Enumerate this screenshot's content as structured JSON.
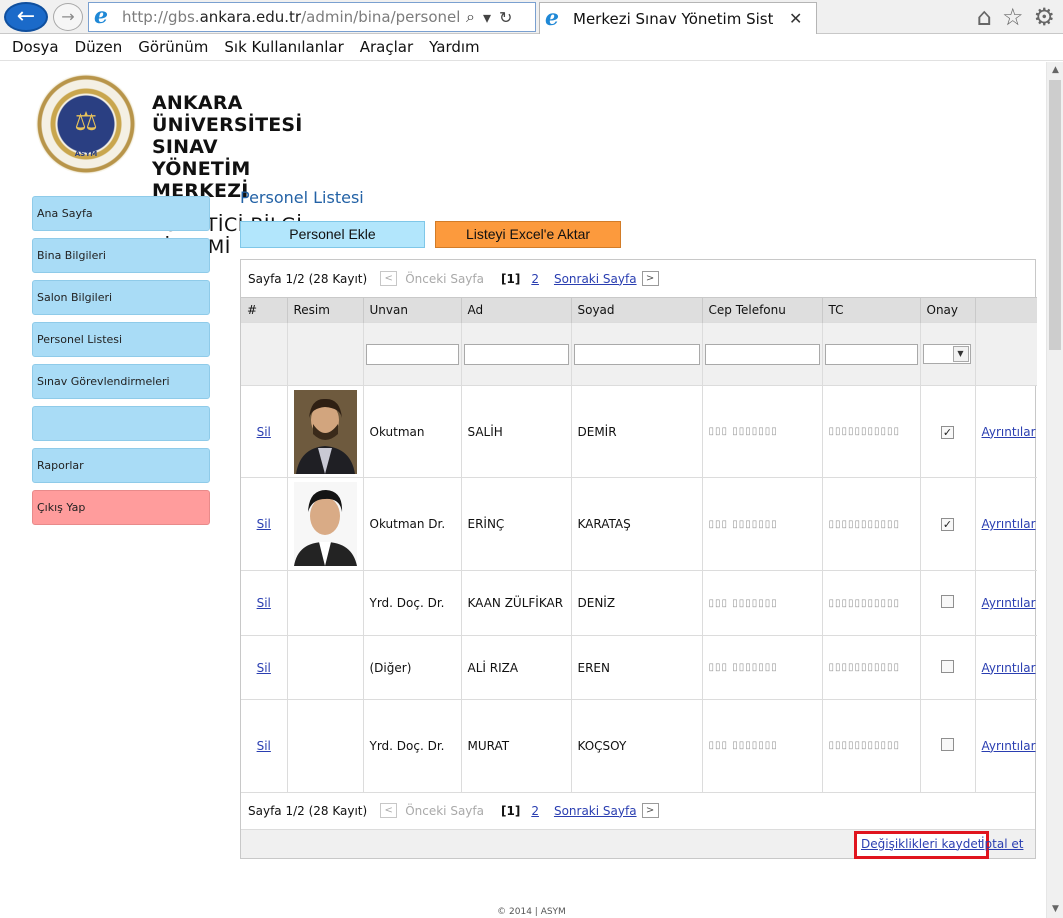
{
  "browser": {
    "url_prefix": "http://gbs.",
    "url_domain": "ankara.edu.tr",
    "url_path": "/admin/bina/personellistes",
    "tab_title": "Merkezi Sınav Yönetim Sist...",
    "tab_close": "✕"
  },
  "menubar": {
    "items": [
      "Dosya",
      "Düzen",
      "Görünüm",
      "Sık Kullanılanlar",
      "Araçlar",
      "Yardım"
    ]
  },
  "header": {
    "line1": "ANKARA ÜNİVERSİTESİ",
    "line2": "SINAV YÖNETİM MERKEZİ",
    "line3": "YÖNETİCİ BİLGİ SİSTEMİ",
    "logo_text": "ASYM"
  },
  "sidebar": {
    "items": [
      {
        "label": "Ana Sayfa"
      },
      {
        "label": "Bina Bilgileri"
      },
      {
        "label": "Salon Bilgileri"
      },
      {
        "label": "Personel Listesi"
      },
      {
        "label": "Sınav Görevlendirmeleri"
      },
      {
        "label": ""
      },
      {
        "label": "Raporlar"
      },
      {
        "label": "Çıkış Yap"
      }
    ]
  },
  "main": {
    "title": "Personel Listesi",
    "add_button": "Personel Ekle",
    "excel_button": "Listeyi Excel'e Aktar"
  },
  "pager": {
    "info": "Sayfa 1/2 (28 Kayıt)",
    "prev": "Önceki Sayfa",
    "current": "[1]",
    "page2": "2",
    "next": "Sonraki Sayfa"
  },
  "table": {
    "headers": [
      "#",
      "Resim",
      "Unvan",
      "Ad",
      "Soyad",
      "Cep Telefonu",
      "TC",
      "Onay",
      ""
    ],
    "rows": [
      {
        "action": "Sil",
        "unvan": "Okutman",
        "ad": "SALİH",
        "soyad": "DEMİR",
        "phone": "▯▯▯ ▯▯▯▯▯▯▯",
        "tc": "▯▯▯▯▯▯▯▯▯▯▯",
        "onay": true,
        "details": "Ayrıntılar"
      },
      {
        "action": "Sil",
        "unvan": "Okutman Dr.",
        "ad": "ERİNÇ",
        "soyad": "KARATAŞ",
        "phone": "▯▯▯ ▯▯▯▯▯▯▯",
        "tc": "▯▯▯▯▯▯▯▯▯▯▯",
        "onay": true,
        "details": "Ayrıntılar"
      },
      {
        "action": "Sil",
        "unvan": "Yrd. Doç. Dr.",
        "ad": "KAAN ZÜLFİKAR",
        "soyad": "DENİZ",
        "phone": "▯▯▯ ▯▯▯▯▯▯▯",
        "tc": "▯▯▯▯▯▯▯▯▯▯▯",
        "onay": false,
        "details": "Ayrıntılar"
      },
      {
        "action": "Sil",
        "unvan": "(Diğer)",
        "ad": "ALİ RIZA",
        "soyad": "EREN",
        "phone": "▯▯▯ ▯▯▯▯▯▯▯",
        "tc": "▯▯▯▯▯▯▯▯▯▯▯",
        "onay": false,
        "details": "Ayrıntılar"
      },
      {
        "action": "Sil",
        "unvan": "Yrd. Doç. Dr.",
        "ad": "MURAT",
        "soyad": "KOÇSOY",
        "phone": "▯▯▯ ▯▯▯▯▯▯▯",
        "tc": "▯▯▯▯▯▯▯▯▯▯▯",
        "onay": false,
        "details": "Ayrıntılar"
      }
    ]
  },
  "actions": {
    "save": "Değişiklikleri kaydet",
    "cancel": "İptal et"
  },
  "footer": {
    "copyright": "© 2014 | ASYM"
  },
  "colors": {
    "sidebar_item": "#a9dcf6",
    "sidebar_logout": "#ff9c9c",
    "add_button": "#b2e6fc",
    "excel_button": "#fc9a3d",
    "title_blue": "#2362a6",
    "highlight_red": "#e0141e"
  }
}
